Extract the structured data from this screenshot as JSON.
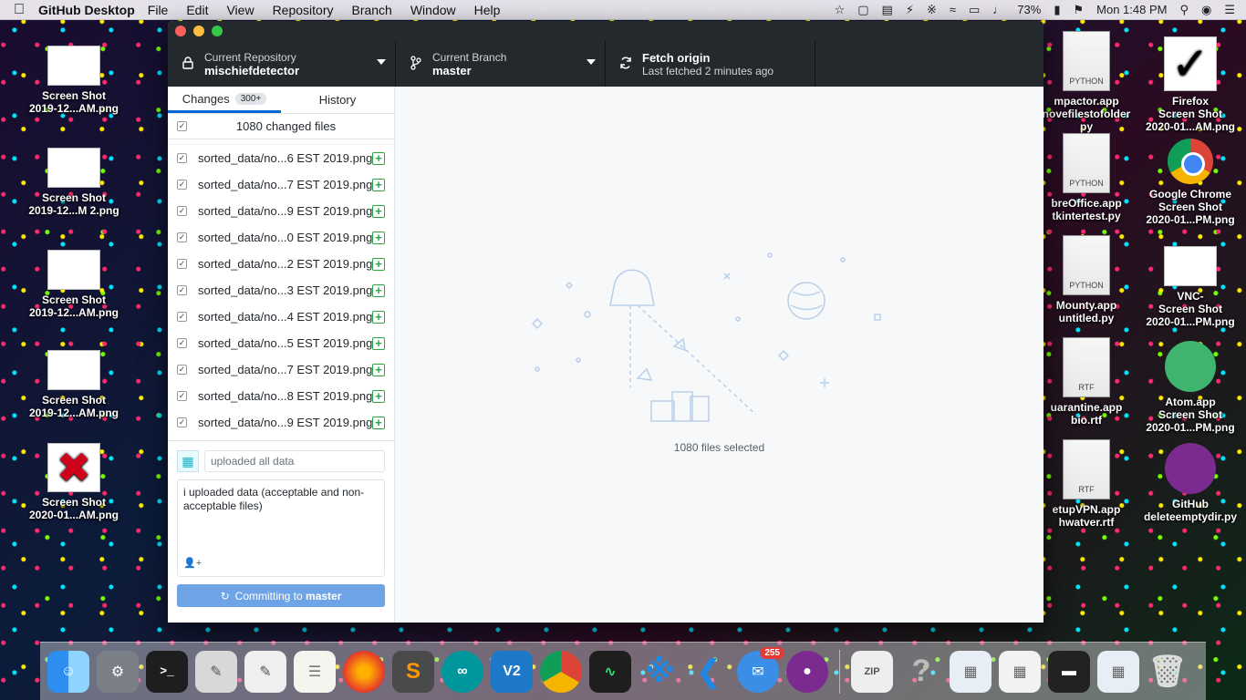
{
  "menubar": {
    "app": "GitHub Desktop",
    "menus": [
      "File",
      "Edit",
      "View",
      "Repository",
      "Branch",
      "Window",
      "Help"
    ],
    "battery": "73%",
    "clock": "Mon 1:48 PM"
  },
  "desktop_left": [
    {
      "label": "Screen Shot\n2019-12...AM.png"
    },
    {
      "label": "Screen Shot\n2019-12...M 2.png"
    },
    {
      "label": "Screen Shot\n2019-12...AM.png"
    },
    {
      "label": "Screen Shot\n2019-12...AM.png"
    },
    {
      "label": "Screen Shot\n2020-01...AM.png"
    }
  ],
  "desktop_right": [
    {
      "label": "Firefox\nScreen Shot\n2020-01...AM.png"
    },
    {
      "label": "Google Chrome\nScreen Shot\n2020-01...PM.png"
    },
    {
      "label": "VNC-\nScreen Shot\n2020-01...PM.png"
    },
    {
      "label": "Atom.app\nScreen Shot\n2020-01...PM.png"
    },
    {
      "label": "GitHub\ndeleteemptydir.py"
    }
  ],
  "desktop_mid": [
    {
      "label": "mpactor.app\nnovefilestofolder\npy",
      "type": "PYTHON"
    },
    {
      "label": "breOffice.app\ntkintertest.py",
      "type": "PYTHON"
    },
    {
      "label": "Mounty.app\nuntitled.py",
      "type": "PYTHON"
    },
    {
      "label": "uarantine.app\nbio.rtf",
      "type": "RTF"
    },
    {
      "label": "etupVPN.app\nhwatver.rtf",
      "type": "RTF"
    }
  ],
  "toolbar": {
    "repo_label": "Current Repository",
    "repo_value": "mischiefdetector",
    "branch_label": "Current Branch",
    "branch_value": "master",
    "fetch_label": "Fetch origin",
    "fetch_sub": "Last fetched 2 minutes ago"
  },
  "tabs": {
    "changes": "Changes",
    "changes_count": "300+",
    "history": "History"
  },
  "changed_files_header": "1080 changed files",
  "files": [
    "sorted_data/no...6 EST 2019.png",
    "sorted_data/no...7 EST 2019.png",
    "sorted_data/no...9 EST 2019.png",
    "sorted_data/no...0 EST 2019.png",
    "sorted_data/no...2 EST 2019.png",
    "sorted_data/no...3 EST 2019.png",
    "sorted_data/no...4 EST 2019.png",
    "sorted_data/no...5 EST 2019.png",
    "sorted_data/no...7 EST 2019.png",
    "sorted_data/no...8 EST 2019.png",
    "sorted_data/no...9 EST 2019.png"
  ],
  "commit": {
    "summary_value": "uploaded all data",
    "description": "i uploaded data (acceptable and non-acceptable files)",
    "button_prefix": "Committing to",
    "button_branch": "master"
  },
  "main": {
    "caption": "1080 files selected"
  },
  "dock": {
    "badge_count": "255"
  },
  "colors": {
    "toolbar_bg": "#24292e",
    "accent_blue": "#0366d6",
    "commit_button": "#6ea4e6",
    "added_green": "#28a745"
  }
}
